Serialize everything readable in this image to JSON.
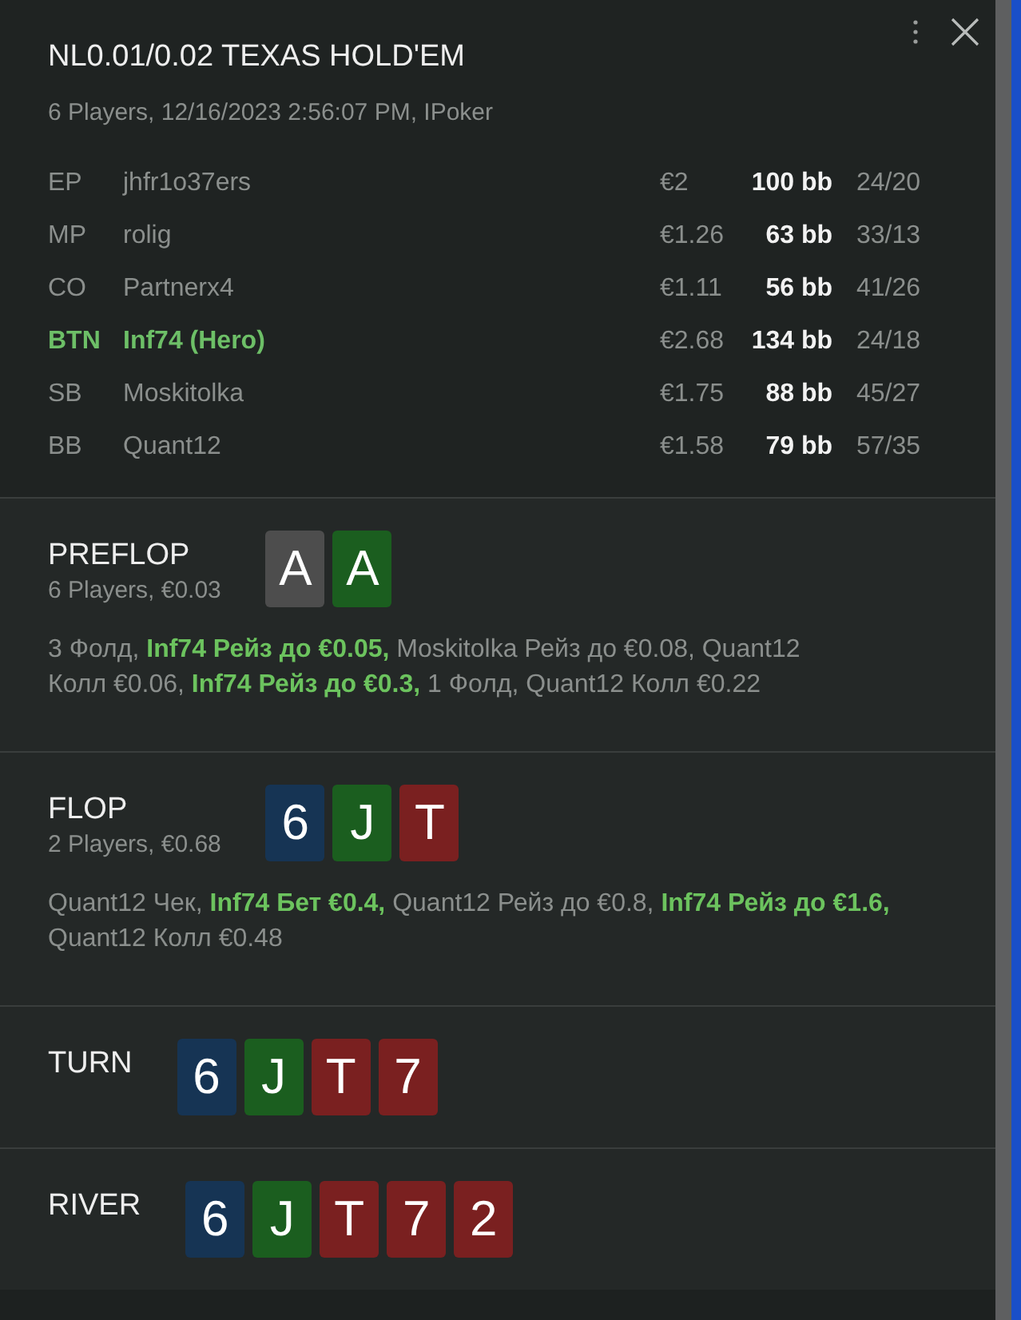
{
  "header": {
    "title": "NL0.01/0.02 TEXAS HOLD'EM",
    "subtitle": "6 Players, 12/16/2023 2:56:07 PM, IPoker"
  },
  "players": [
    {
      "position": "EP",
      "name": "jhfr1o37ers",
      "stack": "€2",
      "bb": "100 bb",
      "stats": "24/20",
      "hero": false
    },
    {
      "position": "MP",
      "name": "rolig",
      "stack": "€1.26",
      "bb": "63 bb",
      "stats": "33/13",
      "hero": false
    },
    {
      "position": "CO",
      "name": "Partnerx4",
      "stack": "€1.11",
      "bb": "56 bb",
      "stats": "41/26",
      "hero": false
    },
    {
      "position": "BTN",
      "name": "Inf74 (Hero)",
      "stack": "€2.68",
      "bb": "134 bb",
      "stats": "24/18",
      "hero": true
    },
    {
      "position": "SB",
      "name": "Moskitolka",
      "stack": "€1.75",
      "bb": "88 bb",
      "stats": "45/27",
      "hero": false
    },
    {
      "position": "BB",
      "name": "Quant12",
      "stack": "€1.58",
      "bb": "79 bb",
      "stats": "57/35",
      "hero": false
    }
  ],
  "streets": [
    {
      "name": "PREFLOP",
      "info": "6 Players, €0.03",
      "cards": [
        {
          "rank": "A",
          "color": "#4d4d4d"
        },
        {
          "rank": "A",
          "color": "#1b5e1f"
        }
      ],
      "actions": "3 Фолд, **Inf74 Рейз до €0.05,** Moskitolka Рейз до €0.08, Quant12 Колл €0.06, **Inf74 Рейз до €0.3,** 1 Фолд, Quant12 Колл €0.22"
    },
    {
      "name": "FLOP",
      "info": "2 Players, €0.68",
      "cards": [
        {
          "rank": "6",
          "color": "#163454"
        },
        {
          "rank": "J",
          "color": "#1b5e1f"
        },
        {
          "rank": "T",
          "color": "#7a2020"
        }
      ],
      "actions": "Quant12 Чек, **Inf74 Бет €0.4,** Quant12 Рейз до €0.8, **Inf74 Рейз до €1.6,** Quant12 Колл €0.48"
    },
    {
      "name": "TURN",
      "cards": [
        {
          "rank": "6",
          "color": "#163454"
        },
        {
          "rank": "J",
          "color": "#1b5e1f"
        },
        {
          "rank": "T",
          "color": "#7a2020"
        },
        {
          "rank": "7",
          "color": "#7a2020"
        }
      ]
    },
    {
      "name": "RIVER",
      "cards": [
        {
          "rank": "6",
          "color": "#163454"
        },
        {
          "rank": "J",
          "color": "#1b5e1f"
        },
        {
          "rank": "T",
          "color": "#7a2020"
        },
        {
          "rank": "7",
          "color": "#7a2020"
        },
        {
          "rank": "2",
          "color": "#7a2020"
        }
      ]
    }
  ]
}
